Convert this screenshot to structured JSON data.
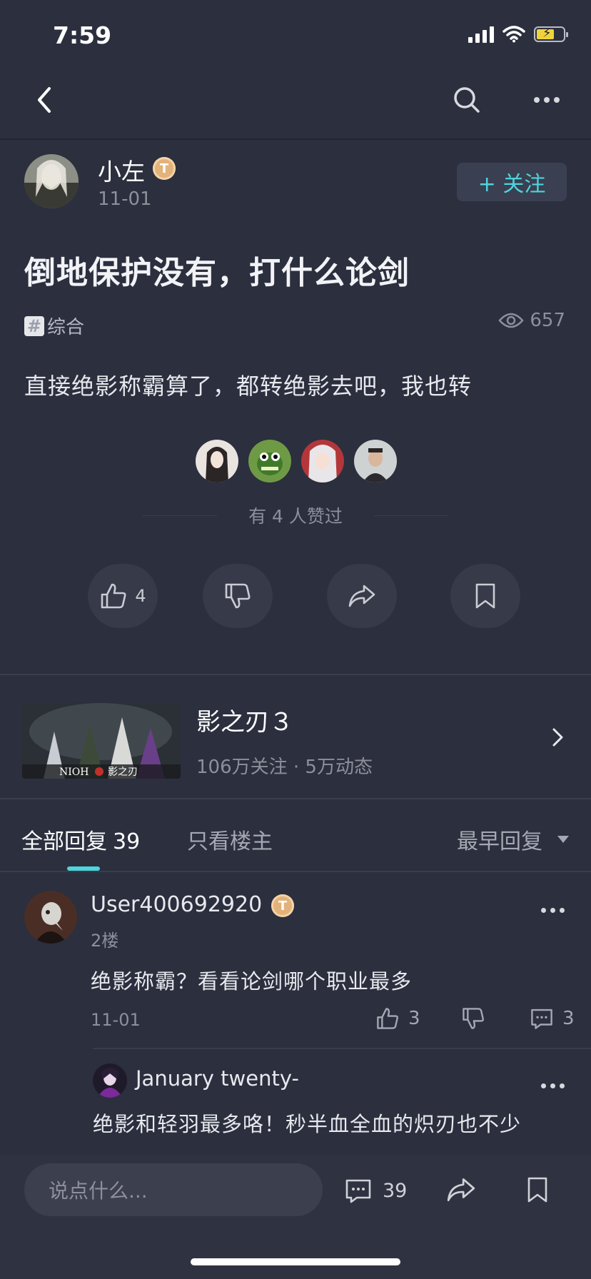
{
  "status": {
    "time": "7:59"
  },
  "post": {
    "author": "小左",
    "level_badge": "T",
    "date": "11-01",
    "follow_label": "+ 关注",
    "title": "倒地保护没有，打什么论剑",
    "tag": "综合",
    "views": "657",
    "body": "直接绝影称霸算了，都转绝影去吧，我也转",
    "liked_text": "有 4 人赞过",
    "like_count": "4"
  },
  "game": {
    "name": "影之刃３",
    "stats": "106万关注 · 5万动态"
  },
  "tabs": {
    "all_label": "全部回复",
    "all_count": "39",
    "op_only": "只看楼主",
    "sort": "最早回复"
  },
  "comments": [
    {
      "user": "User400692920",
      "level_badge": "T",
      "floor": "2楼",
      "text": "绝影称霸？看看论剑哪个职业最多",
      "date": "11-01",
      "likes": "3",
      "replies": "3",
      "reply": {
        "user": "January twenty-",
        "text": "绝影和轻羽最多咯！秒半血全血的炽刃也不少"
      }
    }
  ],
  "bottom": {
    "placeholder": "说点什么...",
    "comment_count": "39"
  },
  "colors": {
    "accent": "#4fd3dd",
    "background": "#2b2f3e",
    "badge": "#e3b27a"
  }
}
